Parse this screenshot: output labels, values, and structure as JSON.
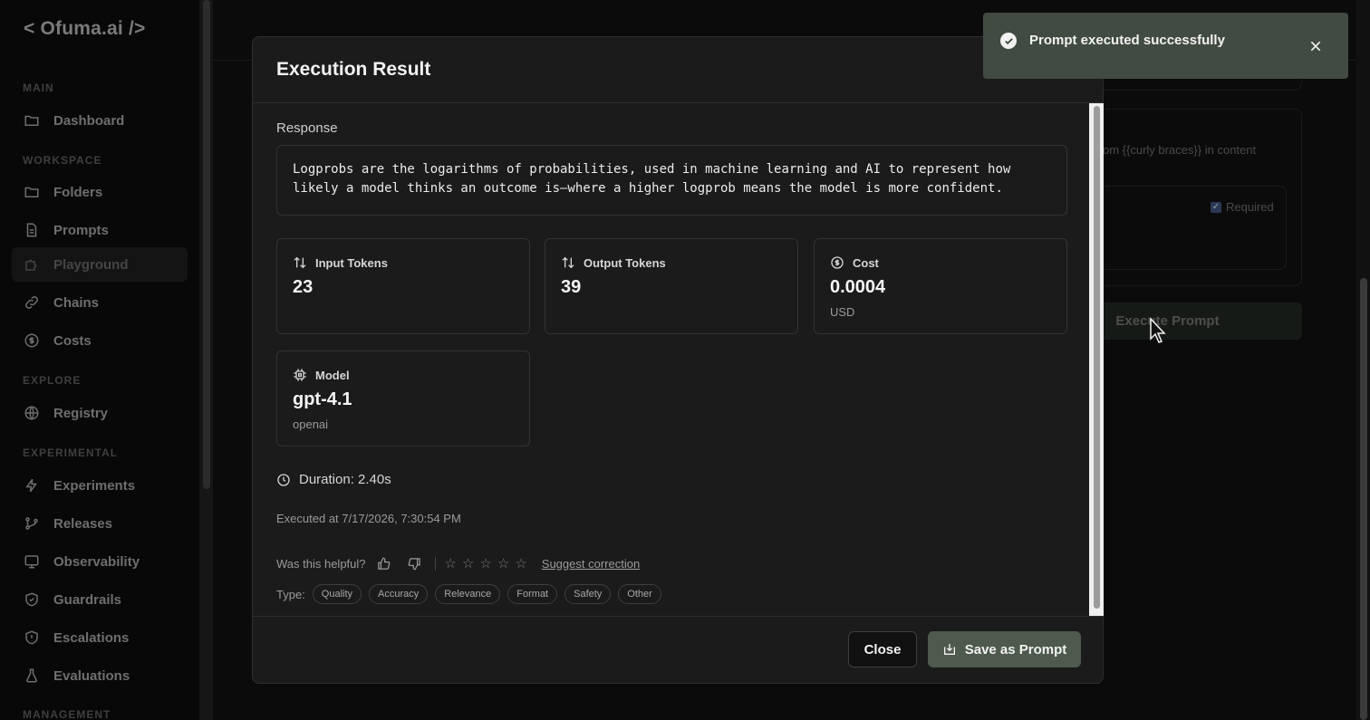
{
  "app": {
    "logo": "< Ofuma.ai />"
  },
  "sidebar": {
    "sections": {
      "main": "MAIN",
      "workspace": "WORKSPACE",
      "explore": "EXPLORE",
      "experimental": "EXPERIMENTAL",
      "management": "MANAGEMENT"
    },
    "items": {
      "dashboard": "Dashboard",
      "folders": "Folders",
      "prompts": "Prompts",
      "playground": "Playground",
      "chains": "Chains",
      "costs": "Costs",
      "registry": "Registry",
      "experiments": "Experiments",
      "releases": "Releases",
      "observability": "Observability",
      "guardrails": "Guardrails",
      "escalations": "Escalations",
      "evaluations": "Evaluations"
    },
    "active": "playground"
  },
  "background": {
    "hint_text": "om {{curly braces}} in content",
    "required_label": "Required",
    "execute_button": "Execute Prompt"
  },
  "modal": {
    "title": "Execution Result",
    "response_label": "Response",
    "response_text": "Logprobs are the logarithms of probabilities, used in machine learning and AI to represent how likely a model thinks an outcome is—where a higher logprob means the model is more confident.",
    "stats": {
      "input_tokens": {
        "label": "Input Tokens",
        "value": "23"
      },
      "output_tokens": {
        "label": "Output Tokens",
        "value": "39"
      },
      "cost": {
        "label": "Cost",
        "value": "0.0004",
        "unit": "USD"
      },
      "model": {
        "label": "Model",
        "value": "gpt-4.1",
        "provider": "openai"
      }
    },
    "duration": "Duration: 2.40s",
    "executed_at": "Executed at 7/17/2026, 7:30:54 PM",
    "feedback": {
      "question": "Was this helpful?",
      "suggest": "Suggest correction",
      "type_label": "Type:",
      "types": [
        "Quality",
        "Accuracy",
        "Relevance",
        "Format",
        "Safety",
        "Other"
      ],
      "stars": [
        "☆",
        "☆",
        "☆",
        "☆",
        "☆"
      ]
    },
    "buttons": {
      "close": "Close",
      "save": "Save as Prompt"
    }
  },
  "toast": {
    "message": "Prompt executed successfully"
  },
  "colors": {
    "toast_bg": "#414b41",
    "save_button": "#4d5a4d"
  }
}
